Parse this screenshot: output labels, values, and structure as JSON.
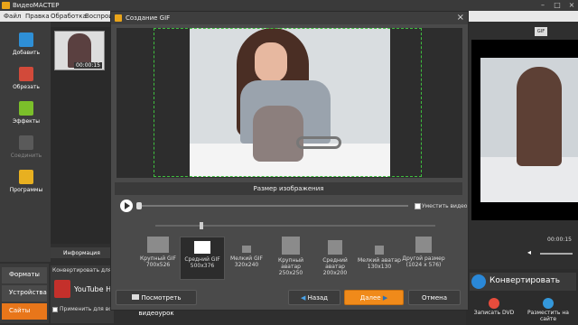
{
  "app": {
    "title": "ВидеоМАСТЕР",
    "menu": [
      "Файл",
      "Правка",
      "Обработка",
      "Воспрои"
    ]
  },
  "sidebar": {
    "items": [
      {
        "label": "Добавить",
        "icon": "add-video-icon",
        "color": "#2e8fd6"
      },
      {
        "label": "Обрезать",
        "icon": "cut-icon",
        "color": "#d24a3a"
      },
      {
        "label": "Эффекты",
        "icon": "effects-icon",
        "color": "#7bbf2a"
      },
      {
        "label": "Соединить",
        "icon": "join-icon",
        "color": "#777777"
      },
      {
        "label": "Программы",
        "icon": "programs-icon",
        "color": "#e8b020"
      }
    ]
  },
  "thumbnail": {
    "duration": "00:00:15"
  },
  "info_tab": {
    "label": "Информация"
  },
  "bottom_tabs": {
    "items": [
      "Форматы",
      "Устройства",
      "Сайты"
    ],
    "active": "Сайты"
  },
  "convert_for": {
    "label": "Конвертировать для:",
    "target": "YouTube H",
    "apply_all": "Применить для всех"
  },
  "preview": {
    "time": "00:00:15"
  },
  "convert": {
    "label": "Конвертировать",
    "burn_dvd": "Записать DVD",
    "publish": "Разместить на сайте"
  },
  "dialog": {
    "title": "Создание GIF",
    "size_section": "Размер изображения",
    "fit_video": "Уместить видео",
    "options": [
      {
        "name": "Крупный GIF",
        "size": "700x526"
      },
      {
        "name": "Средний GIF",
        "size": "500x376"
      },
      {
        "name": "Мелкий GIF",
        "size": "320x240"
      },
      {
        "name": "Крупный аватар",
        "size": "250x250"
      },
      {
        "name": "Средний аватар",
        "size": "200x200"
      },
      {
        "name": "Мелкий аватар",
        "size": "130x130"
      },
      {
        "name": "Другой размер",
        "size": "(1024 x 576)"
      }
    ],
    "selected": "Средний GIF",
    "buttons": {
      "watch_tutorial": "Посмотреть видеоурок",
      "back": "Назад",
      "next": "Далее",
      "cancel": "Отмена"
    }
  }
}
